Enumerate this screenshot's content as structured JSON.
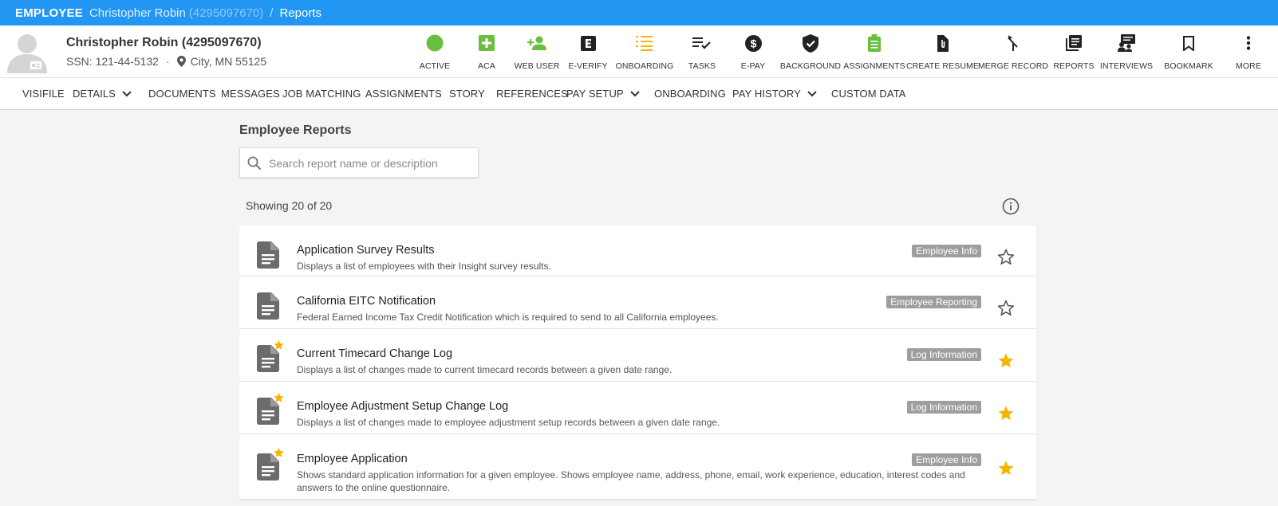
{
  "breadcrumb": {
    "entity": "EMPLOYEE",
    "name": "Christopher Robin",
    "id": "(4295097670)",
    "separator": "/",
    "page": "Reports"
  },
  "employee": {
    "title": "Christopher Robin (4295097670)",
    "ssn": "SSN: 121-44-5132",
    "dot": "·",
    "location": "City, MN 55125"
  },
  "actions": [
    {
      "label": "ACTIVE",
      "icon": "active-status-icon",
      "color": "#6abf40"
    },
    {
      "label": "ACA",
      "icon": "aca-plus-icon",
      "color": "#6abf40"
    },
    {
      "label": "WEB USER",
      "icon": "add-person-icon",
      "color": "#6abf40"
    },
    {
      "label": "E-VERIFY",
      "icon": "everify-icon",
      "color": "#222222"
    },
    {
      "label": "ONBOARDING",
      "icon": "checklist-icon",
      "color": "#f4b400"
    },
    {
      "label": "TASKS",
      "icon": "tasks-icon",
      "color": "#222222"
    },
    {
      "label": "E-PAY",
      "icon": "dollar-icon",
      "color": "#222222"
    },
    {
      "label": "BACKGROUND",
      "icon": "shield-check-icon",
      "color": "#222222"
    },
    {
      "label": "ASSIGNMENTS",
      "icon": "clipboard-icon",
      "color": "#6abf40"
    },
    {
      "label": "CREATE RESUME",
      "icon": "attach-file-icon",
      "color": "#222222"
    },
    {
      "label": "MERGE RECORD",
      "icon": "merge-icon",
      "color": "#222222"
    },
    {
      "label": "REPORTS",
      "icon": "reports-icon",
      "color": "#222222"
    },
    {
      "label": "INTERVIEWS",
      "icon": "interviews-icon",
      "color": "#222222"
    },
    {
      "label": "BOOKMARK",
      "icon": "bookmark-icon",
      "color": "#222222"
    },
    {
      "label": "MORE",
      "icon": "more-vert-icon",
      "color": "#222222"
    }
  ],
  "nav": [
    {
      "label": "VISIFILE",
      "dropdown": false
    },
    {
      "label": "DETAILS",
      "dropdown": true
    },
    {
      "label": "DOCUMENTS",
      "dropdown": false
    },
    {
      "label": "MESSAGES",
      "dropdown": false
    },
    {
      "label": "JOB MATCHING",
      "dropdown": false
    },
    {
      "label": "ASSIGNMENTS",
      "dropdown": false
    },
    {
      "label": "STORY",
      "dropdown": false
    },
    {
      "label": "REFERENCES",
      "dropdown": false
    },
    {
      "label": "PAY SETUP",
      "dropdown": true
    },
    {
      "label": "ONBOARDING",
      "dropdown": false
    },
    {
      "label": "PAY HISTORY",
      "dropdown": true
    },
    {
      "label": "CUSTOM DATA",
      "dropdown": false
    }
  ],
  "main": {
    "title": "Employee Reports",
    "search_placeholder": "Search report name or description",
    "search_value": "",
    "showing": "Showing 20 of 20"
  },
  "reports": [
    {
      "title": "Application Survey Results",
      "desc": "Displays a list of employees with their Insight survey results.",
      "tag": "Employee Info",
      "favorite": false
    },
    {
      "title": "California EITC Notification",
      "desc": "Federal Earned Income Tax Credit Notification which is required to send to all California employees.",
      "tag": "Employee Reporting",
      "favorite": false
    },
    {
      "title": "Current Timecard Change Log",
      "desc": "Displays a list of changes made to current timecard records between a given date range.",
      "tag": "Log Information",
      "favorite": true
    },
    {
      "title": "Employee Adjustment Setup Change Log",
      "desc": "Displays a list of changes made to employee adjustment setup records between a given date range.",
      "tag": "Log Information",
      "favorite": true
    },
    {
      "title": "Employee Application",
      "desc": "Shows standard application information for a given employee. Shows employee name, address, phone, email, work experience, education, interest codes and answers to the online questionnaire.",
      "tag": "Employee Info",
      "favorite": true
    }
  ],
  "colors": {
    "brand_blue": "#2196f3",
    "green": "#6abf40",
    "star_gold": "#f4b400",
    "tag_gray": "#9e9e9e"
  }
}
